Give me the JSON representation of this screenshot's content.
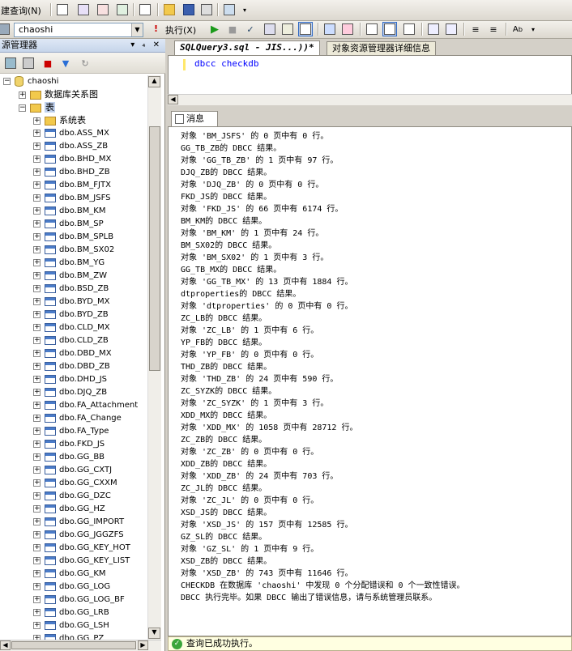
{
  "toolbar": {
    "new_query_label": "建查询(N)",
    "execute_label": "执行(X)"
  },
  "db_selector": {
    "value": "chaoshi"
  },
  "explorer": {
    "title": "源管理器",
    "pin_controls": "▾ ₄ ✕",
    "database": "chaoshi",
    "diagrams_label": "数据库关系图",
    "tables_label": "表",
    "system_tables_label": "系统表",
    "tables": [
      "dbo.ASS_MX",
      "dbo.ASS_ZB",
      "dbo.BHD_MX",
      "dbo.BHD_ZB",
      "dbo.BM_FJTX",
      "dbo.BM_JSFS",
      "dbo.BM_KM",
      "dbo.BM_SP",
      "dbo.BM_SPLB",
      "dbo.BM_SX02",
      "dbo.BM_YG",
      "dbo.BM_ZW",
      "dbo.BSD_ZB",
      "dbo.BYD_MX",
      "dbo.BYD_ZB",
      "dbo.CLD_MX",
      "dbo.CLD_ZB",
      "dbo.DBD_MX",
      "dbo.DBD_ZB",
      "dbo.DHD_JS",
      "dbo.DJQ_ZB",
      "dbo.FA_Attachment",
      "dbo.FA_Change",
      "dbo.FA_Type",
      "dbo.FKD_JS",
      "dbo.GG_BB",
      "dbo.GG_CXTJ",
      "dbo.GG_CXXM",
      "dbo.GG_DZC",
      "dbo.GG_HZ",
      "dbo.GG_IMPORT",
      "dbo.GG_JGGZFS",
      "dbo.GG_KEY_HOT",
      "dbo.GG_KEY_LIST",
      "dbo.GG_KM",
      "dbo.GG_LOG",
      "dbo.GG_LOG_BF",
      "dbo.GG_LRB",
      "dbo.GG_LSH",
      "dbo.GG_PZ"
    ]
  },
  "tabs": {
    "query_tab": "SQLQuery3.sql - JIS...))*",
    "details_tab": "对象资源管理器详细信息"
  },
  "editor": {
    "code": "dbcc checkdb"
  },
  "messages": {
    "tab_label": "消息",
    "lines": [
      "对象 'BM_JSFS' 的 0 页中有 0 行。",
      "GG_TB_ZB的 DBCC 结果。",
      "对象 'GG_TB_ZB' 的 1 页中有 97 行。",
      "DJQ_ZB的 DBCC 结果。",
      "对象 'DJQ_ZB' 的 0 页中有 0 行。",
      "FKD_JS的 DBCC 结果。",
      "对象 'FKD_JS' 的 66 页中有 6174 行。",
      "BM_KM的 DBCC 结果。",
      "对象 'BM_KM' 的 1 页中有 24 行。",
      "BM_SX02的 DBCC 结果。",
      "对象 'BM_SX02' 的 1 页中有 3 行。",
      "GG_TB_MX的 DBCC 结果。",
      "对象 'GG_TB_MX' 的 13 页中有 1884 行。",
      "dtproperties的 DBCC 结果。",
      "对象 'dtproperties' 的 0 页中有 0 行。",
      "ZC_LB的 DBCC 结果。",
      "对象 'ZC_LB' 的 1 页中有 6 行。",
      "YP_FB的 DBCC 结果。",
      "对象 'YP_FB' 的 0 页中有 0 行。",
      "THD_ZB的 DBCC 结果。",
      "对象 'THD_ZB' 的 24 页中有 590 行。",
      "ZC_SYZK的 DBCC 结果。",
      "对象 'ZC_SYZK' 的 1 页中有 3 行。",
      "XDD_MX的 DBCC 结果。",
      "对象 'XDD_MX' 的 1058 页中有 28712 行。",
      "ZC_ZB的 DBCC 结果。",
      "对象 'ZC_ZB' 的 0 页中有 0 行。",
      "XDD_ZB的 DBCC 结果。",
      "对象 'XDD_ZB' 的 24 页中有 703 行。",
      "ZC_JL的 DBCC 结果。",
      "对象 'ZC_JL' 的 0 页中有 0 行。",
      "XSD_JS的 DBCC 结果。",
      "对象 'XSD_JS' 的 157 页中有 12585 行。",
      "GZ_SL的 DBCC 结果。",
      "对象 'GZ_SL' 的 1 页中有 9 行。",
      "XSD_ZB的 DBCC 结果。",
      "对象 'XSD_ZB' 的 743 页中有 11646 行。",
      "CHECKDB 在数据库 'chaoshi' 中发现 0 个分配错误和 0 个一致性错误。",
      "DBCC 执行完毕。如果 DBCC 输出了错误信息，请与系统管理员联系。"
    ]
  },
  "status": {
    "text": "查询已成功执行。"
  }
}
